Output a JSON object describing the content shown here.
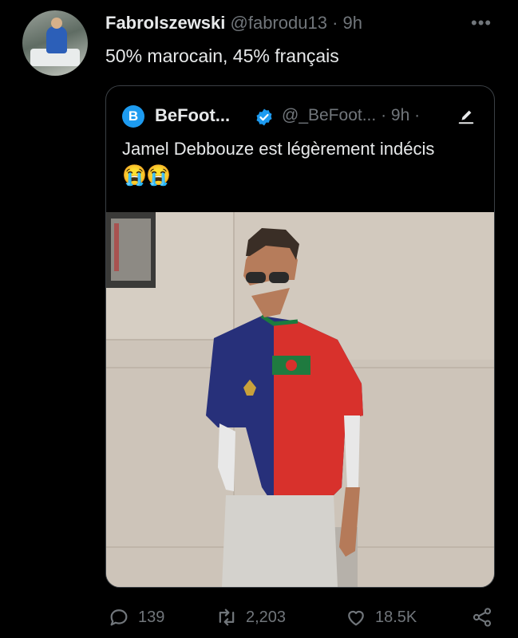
{
  "tweet": {
    "author_name": "FabroIszewski",
    "author_handle": "@fabrodu13",
    "time": "· 9h",
    "more": "•••",
    "text": "50% marocain, 45% français"
  },
  "quoted": {
    "logo_letter": "B",
    "name": "BeFoot...",
    "handle": "@_BeFoot...",
    "time": "· 9h ·",
    "text": "Jamel Debbouze est légèrement indécis",
    "emoji": "😭😭"
  },
  "actions": {
    "replies": "139",
    "retweets": "2,203",
    "likes": "18.5K"
  },
  "colors": {
    "background": "#000000",
    "text": "#e7e9ea",
    "muted": "#71767b",
    "accent": "#1d9bf0",
    "border": "#3b4045"
  },
  "icons": [
    "more-icon",
    "verified-icon",
    "edit-icon",
    "reply-icon",
    "retweet-icon",
    "like-icon",
    "share-icon"
  ]
}
